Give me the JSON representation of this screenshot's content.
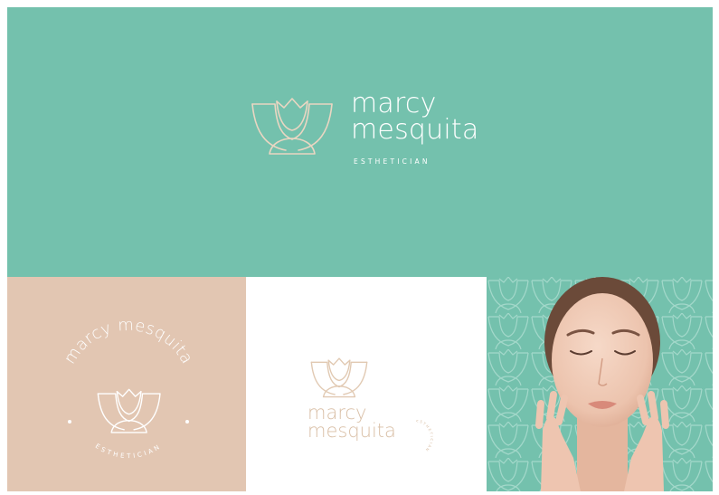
{
  "hero": {
    "name_line1": "marcy",
    "name_line2": "mesquita",
    "tagline": "ESTHETICIAN"
  },
  "badge": {
    "name": "marcy mesquita",
    "tagline": "ESTHETICIAN"
  },
  "stacked": {
    "name_line1": "marcy",
    "name_line2": "mesquita",
    "tagline": "ESTHETICIAN"
  },
  "colors": {
    "teal": "#74c1ad",
    "beige": "#e2c6b2",
    "sand": "#d9bfa6",
    "white": "#ffffff"
  },
  "icons": {
    "logo": "lotus-mark-icon",
    "pattern": "lotus-pattern-icon"
  }
}
